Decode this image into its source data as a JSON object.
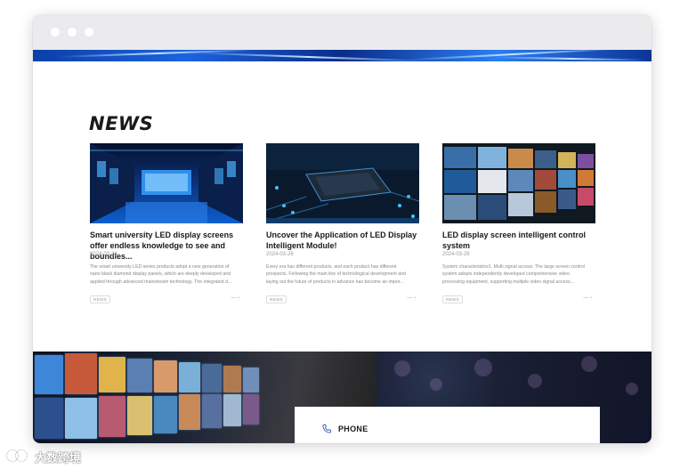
{
  "section_title": "NEWS",
  "cards": [
    {
      "headline": "Smart university LED display screens offer endless knowledge to see and boundles...",
      "date": "2024-03-26",
      "excerpt": "The smart university LED series products adopt a new generation of nano black diamond display panels, which are deeply developed and applied through advanced mainstream technology. The integrated d...",
      "tag": "NEWS",
      "more": "— ›"
    },
    {
      "headline": "Uncover the Application of LED Display Intelligent Module!",
      "date": "2024-03-26",
      "excerpt": "Every era has different products, and each product has different prospects. Following the main line of technological development and laying out the future of products in advance has become an impor...",
      "tag": "NEWS",
      "more": "— ›"
    },
    {
      "headline": "LED display screen intelligent control system",
      "date": "2024-03-26",
      "excerpt": "System characteristics1. Multi signal access: The large screen control system adopts independently developed comprehensive video processing equipment, supporting multiple video signal access...",
      "tag": "NEWS",
      "more": "— ›"
    }
  ],
  "contact": {
    "label": "PHONE",
    "icon": "phone-icon"
  },
  "watermark": {
    "text": "大数跨境"
  },
  "colors": {
    "chrome": "#ebebed",
    "banner": "#1b63e0",
    "text": "#1a1a1a",
    "muted": "#888888",
    "footer_dark": "#12152a"
  }
}
